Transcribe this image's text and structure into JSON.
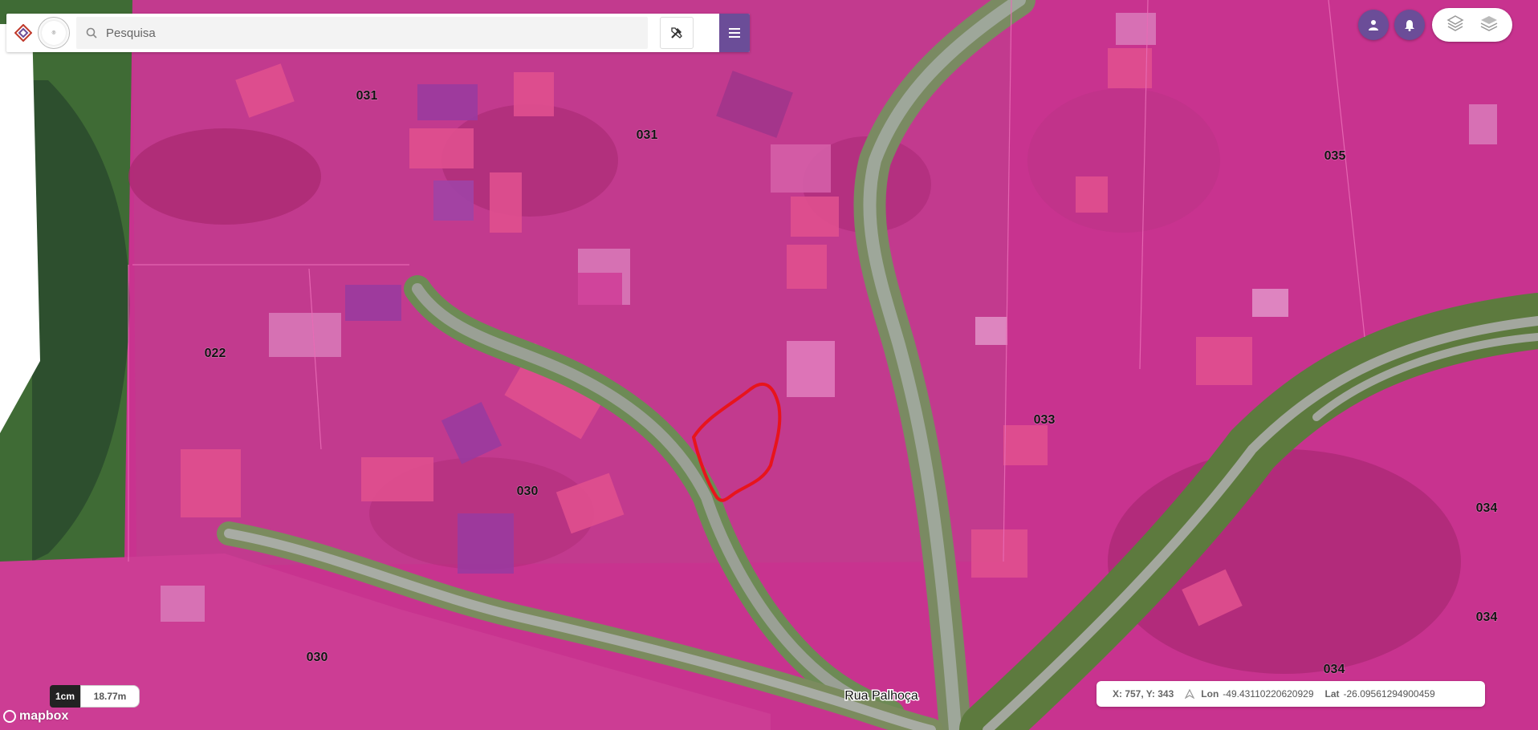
{
  "search": {
    "placeholder": "Pesquisa"
  },
  "parcel_labels": [
    "031",
    "031",
    "022",
    "030",
    "030",
    "033",
    "035",
    "034",
    "034",
    "034"
  ],
  "street_label": "Rua Palhoça",
  "scale": {
    "unit": "1cm",
    "distance": "18.77m"
  },
  "attribution": "mapbox",
  "coords": {
    "xy": "X: 757, Y: 343",
    "lon_label": "Lon",
    "lon": "-49.43110220620929",
    "lat_label": "Lat",
    "lat": "-26.09561294900459"
  },
  "icons": [
    "search-icon",
    "tools-icon",
    "menu-icon",
    "user-icon",
    "bell-icon",
    "layers-outline-icon",
    "layers-icon",
    "north-arrow-icon"
  ],
  "colors": {
    "parcel_fill": "#c8338f",
    "selection": "#e8141c",
    "brand": "#6b4d98"
  }
}
